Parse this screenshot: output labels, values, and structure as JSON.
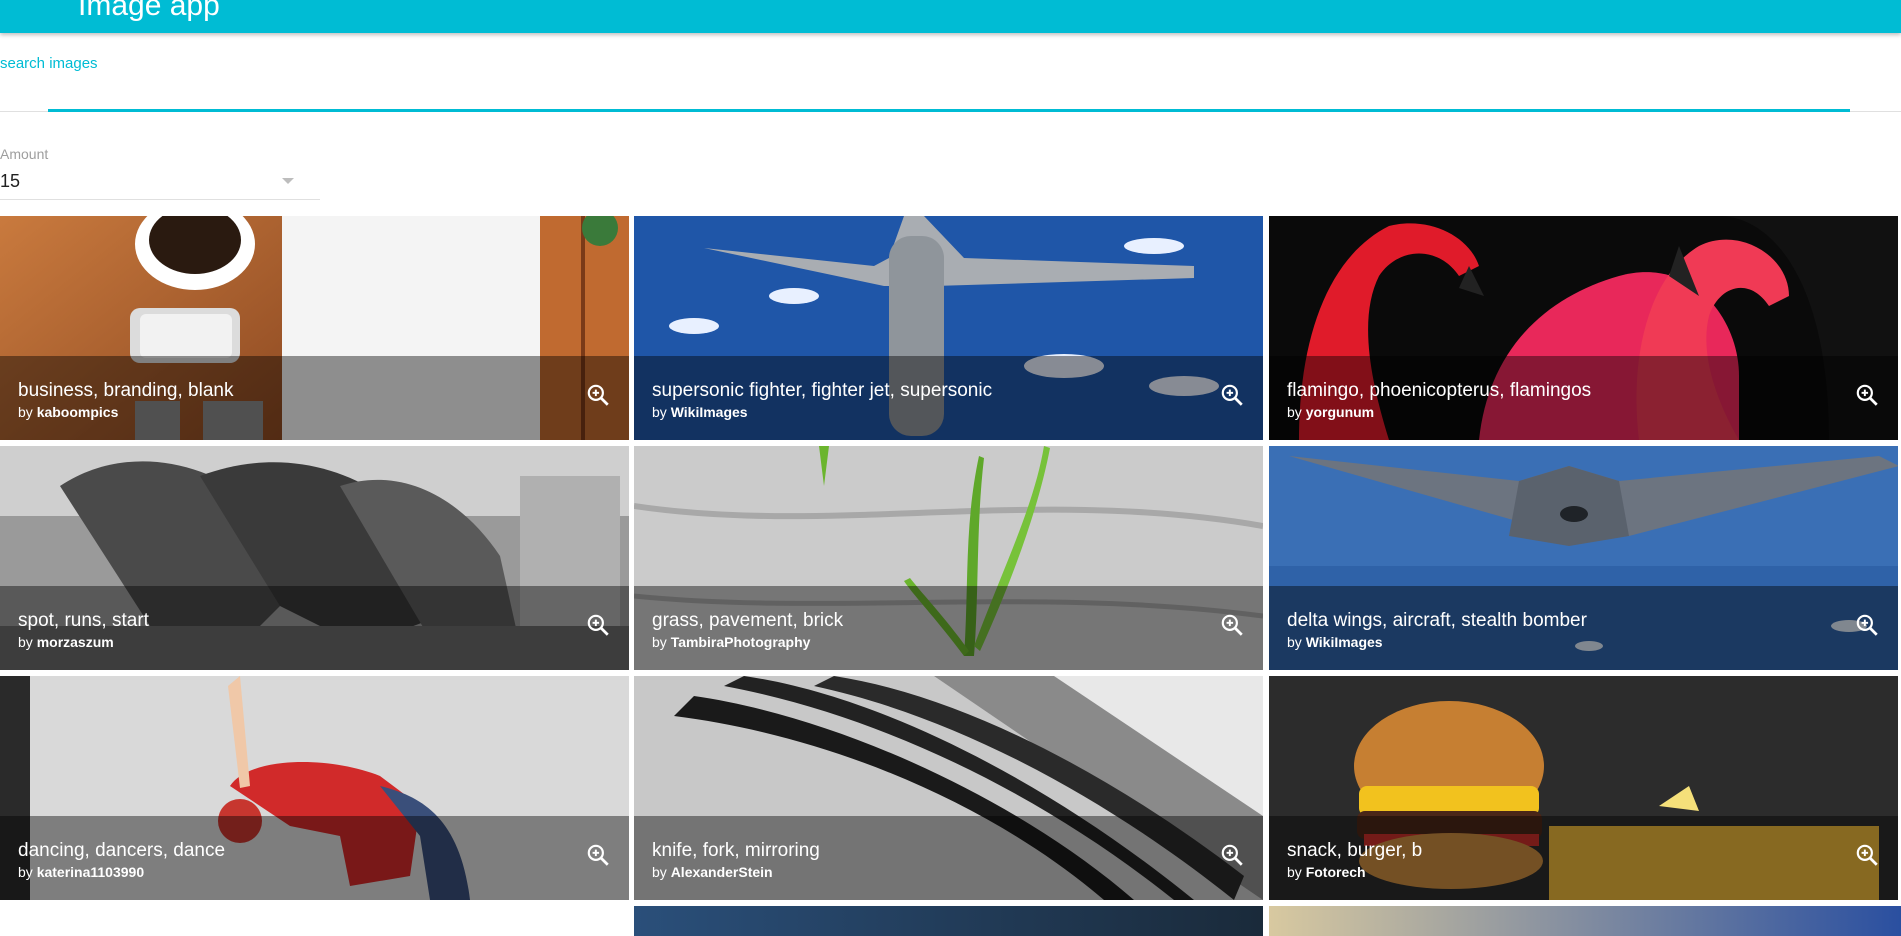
{
  "app": {
    "title": "Image app"
  },
  "search": {
    "label": "search images"
  },
  "amount": {
    "label": "Amount",
    "value": "15"
  },
  "tiles": [
    {
      "title": "business, branding, blank",
      "author": "kaboompics"
    },
    {
      "title": "supersonic fighter, fighter jet, supersonic",
      "author": "WikiImages"
    },
    {
      "title": "flamingo, phoenicopterus, flamingos",
      "author": "yorgunum"
    },
    {
      "title": "spot, runs, start",
      "author": "morzaszum"
    },
    {
      "title": "grass, pavement, brick",
      "author": "TambiraPhotography"
    },
    {
      "title": "delta wings, aircraft, stealth bomber",
      "author": "WikiImages"
    },
    {
      "title": "dancing, dancers, dance",
      "author": "katerina1103990"
    },
    {
      "title": "knife, fork, mirroring",
      "author": "AlexanderStein"
    },
    {
      "title": "snack, burger, b",
      "author": "Fotorech"
    }
  ],
  "by_prefix": "by",
  "icons": {
    "menu": "menu-icon",
    "zoom": "zoom-in-icon",
    "dropdown": "chevron-down-icon"
  },
  "colors": {
    "accent": "#00bcd4"
  }
}
